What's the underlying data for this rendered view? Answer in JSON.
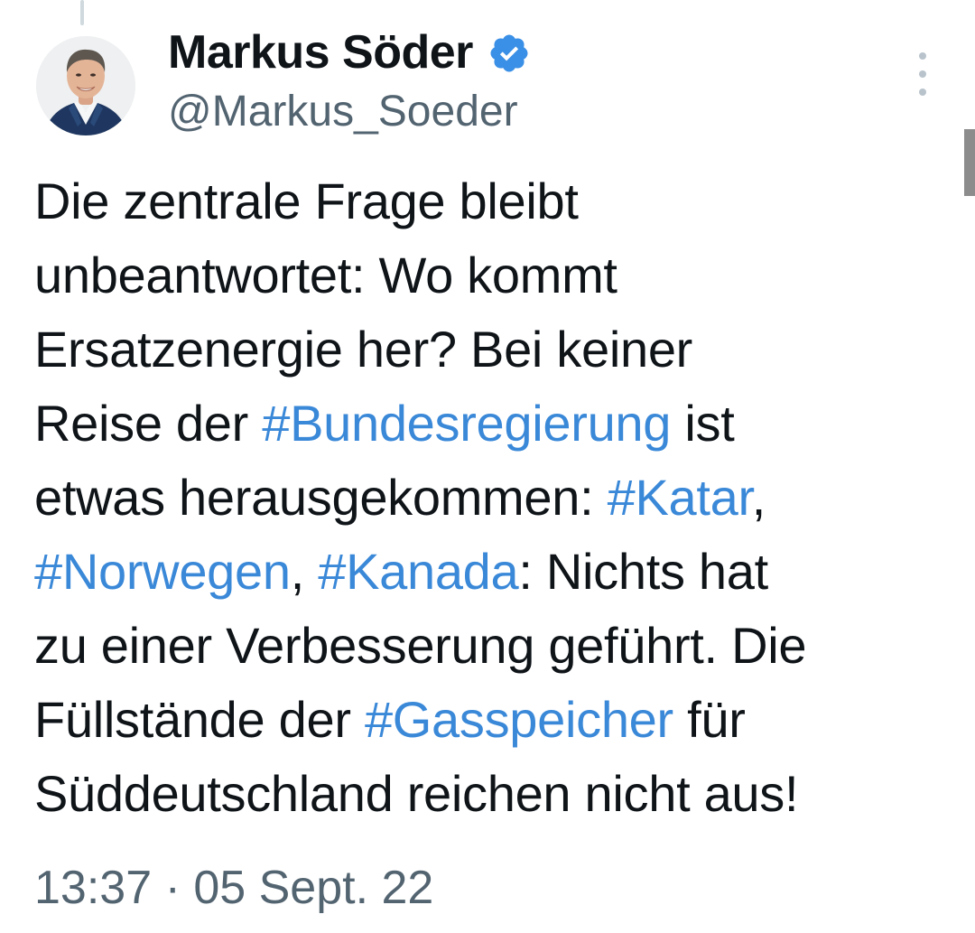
{
  "tweet": {
    "author": {
      "display_name": "Markus Söder",
      "handle": "@Markus_Soeder",
      "verified_icon": "verified-badge-icon",
      "avatar": "profile-photo"
    },
    "more_icon": "more-vertical-icon",
    "text_lines": [
      [
        {
          "t": "Die zentrale Frage bleibt"
        }
      ],
      [
        {
          "t": "unbeantwortet: Wo kommt"
        }
      ],
      [
        {
          "t": "Ersatzenergie her? Bei keiner"
        }
      ],
      [
        {
          "t": "Reise der "
        },
        {
          "t": "#Bundesregierung",
          "tag": true
        },
        {
          "t": " ist"
        }
      ],
      [
        {
          "t": "etwas herausgekommen: "
        },
        {
          "t": "#Katar",
          "tag": true
        },
        {
          "t": ","
        }
      ],
      [
        {
          "t": "#Norwegen",
          "tag": true
        },
        {
          "t": ", "
        },
        {
          "t": "#Kanada",
          "tag": true
        },
        {
          "t": ": Nichts hat"
        }
      ],
      [
        {
          "t": "zu einer Verbesserung geführt. Die"
        }
      ],
      [
        {
          "t": "Füllstände der "
        },
        {
          "t": "#Gasspeicher",
          "tag": true
        },
        {
          "t": " für"
        }
      ],
      [
        {
          "t": "Süddeutschland reichen nicht aus!"
        }
      ]
    ],
    "timestamp": "13:37 · 05 Sept. 22"
  },
  "colors": {
    "text": "#0f1419",
    "secondary_text": "#536471",
    "hashtag": "#3a88d8",
    "verified_badge": "#3a8fe6",
    "background": "#ffffff"
  }
}
